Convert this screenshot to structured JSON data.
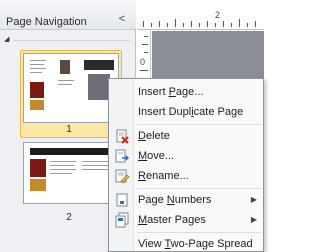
{
  "pane": {
    "title": "Page Navigation",
    "collapse_glyph": "<",
    "pages": [
      {
        "number": "1",
        "selected": true
      },
      {
        "number": "2",
        "selected": false
      }
    ]
  },
  "ruler": {
    "top_number": "2",
    "left_number": "0"
  },
  "context_menu": {
    "items": [
      {
        "pre": "Insert ",
        "key": "P",
        "post": "age...",
        "icon": ""
      },
      {
        "pre": "Insert Dupl",
        "key": "i",
        "post": "cate Page",
        "icon": ""
      },
      {
        "pre": "",
        "key": "D",
        "post": "elete",
        "icon": "delete-page-icon"
      },
      {
        "pre": "",
        "key": "M",
        "post": "ove...",
        "icon": "move-page-icon"
      },
      {
        "pre": "",
        "key": "R",
        "post": "ename...",
        "icon": "rename-page-icon"
      },
      {
        "pre": "Page ",
        "key": "N",
        "post": "umbers",
        "icon": "page-numbers-icon",
        "submenu": true
      },
      {
        "pre": "",
        "key": "M",
        "post": "aster Pages",
        "icon": "master-pages-icon",
        "submenu": true
      },
      {
        "pre": "View ",
        "key": "T",
        "post": "wo-Page Spread",
        "icon": ""
      }
    ]
  },
  "colors": {
    "selection_fill": "#fde8a6",
    "selection_border": "#e9b84a",
    "pane_bg": "#eef0f3",
    "canvas_bg": "#8a8f96"
  }
}
